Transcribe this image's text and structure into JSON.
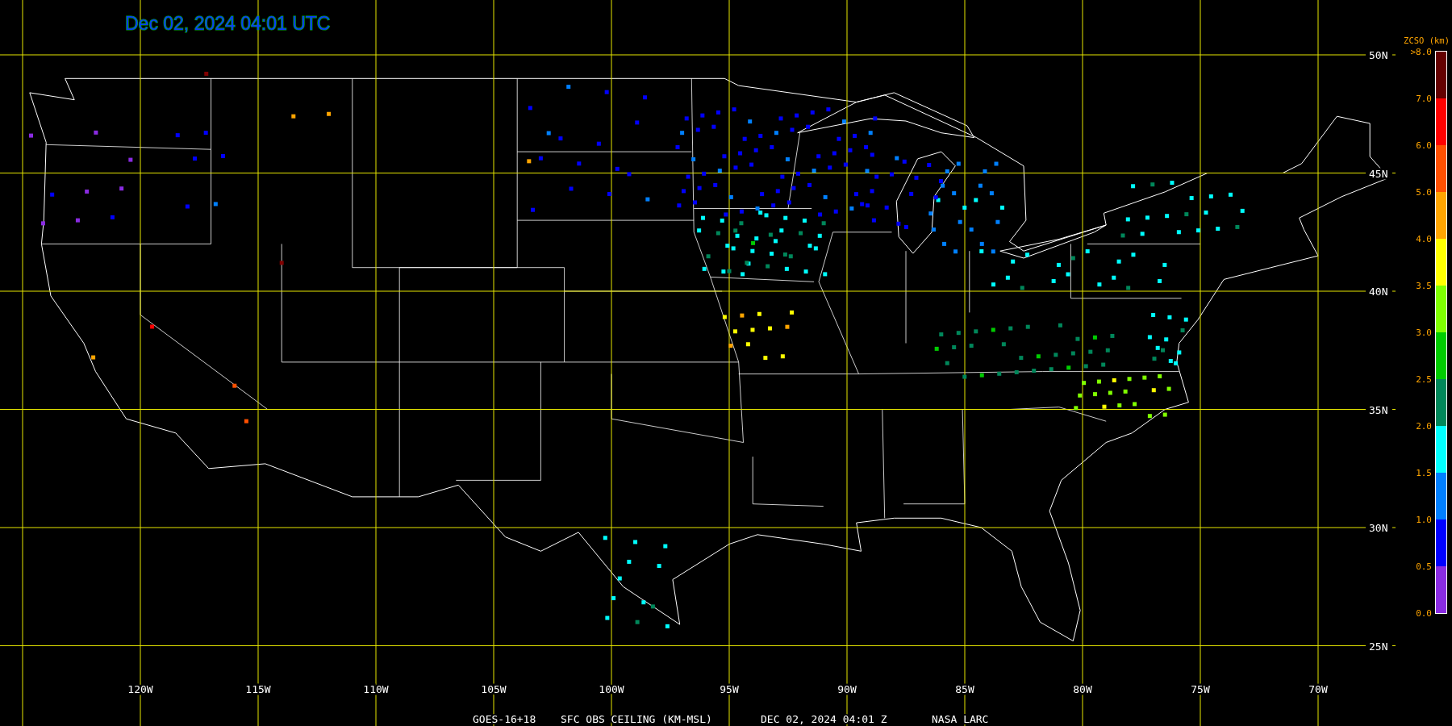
{
  "title": "Dec 02, 2024 04:01 UTC",
  "map": {
    "latitude_labels": [
      "50N",
      "45N",
      "40N",
      "35N",
      "30N",
      "25N"
    ],
    "longitude_labels": [
      "120W",
      "115W",
      "110W",
      "105W",
      "100W",
      "95W",
      "90W",
      "85W",
      "80W",
      "75W",
      "70W"
    ]
  },
  "legend": {
    "title": "ZCSO (km)",
    "labels": [
      ">8.0",
      "7.0",
      "6.0",
      "5.0",
      "4.0",
      "3.5",
      "3.0",
      "2.5",
      "2.0",
      "1.5",
      "1.0",
      "0.5",
      "0.0"
    ],
    "bands": [
      {
        "color": "#8a2be2"
      },
      {
        "color": "#0000ff"
      },
      {
        "color": "#0080ff"
      },
      {
        "color": "#00ffff"
      },
      {
        "color": "#00875a"
      },
      {
        "color": "#00cc00"
      },
      {
        "color": "#80ff00"
      },
      {
        "color": "#ffff00"
      },
      {
        "color": "#ffa500"
      },
      {
        "color": "#ff5000"
      },
      {
        "color": "#ff0000"
      },
      {
        "color": "#640000"
      }
    ]
  },
  "caption": [
    "GOES-16+18",
    "SFC OBS CEILING (KM-MSL)",
    "DEC 02, 2024 04:01 Z",
    "NASA LARC"
  ]
}
